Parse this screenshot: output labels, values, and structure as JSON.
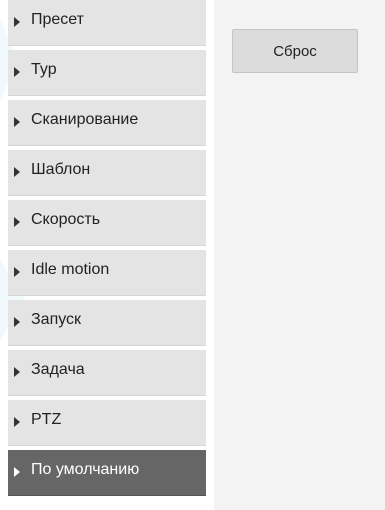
{
  "sidebar": {
    "items": [
      {
        "label": "Пресет",
        "active": false
      },
      {
        "label": "Тур",
        "active": false
      },
      {
        "label": "Сканирование",
        "active": false
      },
      {
        "label": "Шаблон",
        "active": false
      },
      {
        "label": "Скорость",
        "active": false
      },
      {
        "label": "Idle motion",
        "active": false
      },
      {
        "label": "Запуск",
        "active": false
      },
      {
        "label": "Задача",
        "active": false
      },
      {
        "label": "PTZ",
        "active": false
      },
      {
        "label": "По умолчанию",
        "active": true
      }
    ]
  },
  "content": {
    "reset_label": "Сброс"
  },
  "colors": {
    "menu_bg": "#e4e4e4",
    "menu_active_bg": "#666666",
    "content_bg": "#f3f3f3",
    "button_bg": "#dcdcdc"
  }
}
